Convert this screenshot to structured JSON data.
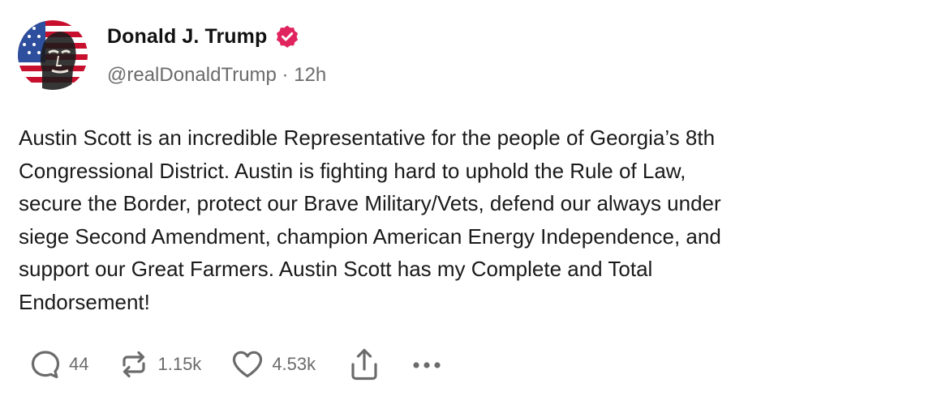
{
  "author": {
    "display_name": "Donald J. Trump",
    "handle": "@realDonaldTrump",
    "separator": " · ",
    "time": "12h",
    "verified_color": "#e0245e"
  },
  "post": {
    "lines": [
      "Austin Scott is an incredible Representative for the people of Georgia’s 8th",
      "Congressional District. Austin is fighting hard to uphold the Rule of Law,",
      "secure the Border, protect our Brave Military/Vets, defend our always under",
      "siege Second Amendment, champion American Energy Independence, and",
      "support our Great Farmers. Austin Scott has my Complete and Total",
      "Endorsement!"
    ]
  },
  "actions": {
    "replies": "44",
    "reposts": "1.15k",
    "likes": "4.53k",
    "icon_color": "#6b6b6b"
  },
  "icons": {
    "reply": "reply-icon",
    "repost": "repost-icon",
    "like": "heart-icon",
    "share": "share-icon",
    "more": "more-icon",
    "verified": "verified-badge-icon"
  }
}
